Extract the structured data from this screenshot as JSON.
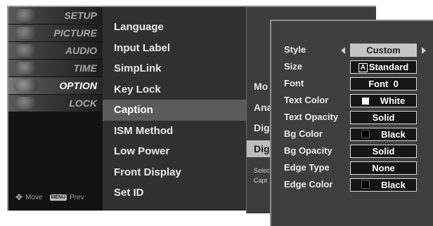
{
  "sidebar": {
    "items": [
      {
        "label": "SETUP",
        "icon": "setup-icon"
      },
      {
        "label": "PICTURE",
        "icon": "picture-icon"
      },
      {
        "label": "AUDIO",
        "icon": "audio-icon"
      },
      {
        "label": "TIME",
        "icon": "clock-icon"
      },
      {
        "label": "OPTION",
        "icon": "option-icon"
      },
      {
        "label": "LOCK",
        "icon": "lock-icon"
      }
    ],
    "active_index": 4,
    "footer": {
      "move_label": "Move",
      "menu_key": "MENU",
      "prev_label": "Prev"
    }
  },
  "menu": {
    "items": [
      "Language",
      "Input Label",
      "SimpLink",
      "Key Lock",
      "Caption",
      "ISM Method",
      "Low Power",
      "Front Display",
      "Set ID"
    ],
    "active_index": 4
  },
  "back_panel": {
    "items": [
      "Mo",
      "Ana",
      "Dig",
      "Dig"
    ],
    "highlight_index": 3,
    "description": [
      "Selec",
      "Capt"
    ]
  },
  "caption_panel": {
    "rows": [
      {
        "label": "Style",
        "value": "Custom",
        "selected": true
      },
      {
        "label": "Size",
        "value": "Standard",
        "glyph": "A"
      },
      {
        "label": "Font",
        "value": "Font  0"
      },
      {
        "label": "Text Color",
        "value": "White",
        "swatch": "#ffffff"
      },
      {
        "label": "Text Opacity",
        "value": "Solid"
      },
      {
        "label": "Bg Color",
        "value": "Black",
        "swatch": "#000000"
      },
      {
        "label": "Bg Opacity",
        "value": "Solid"
      },
      {
        "label": "Edge Type",
        "value": "None"
      },
      {
        "label": "Edge Color",
        "value": "Black",
        "swatch": "#000000"
      }
    ]
  },
  "colors": {
    "selected_value_bg": "#c4c4c4",
    "menu_active_bg": "#5a5a5a",
    "panel_bg": "#3e3e3e"
  }
}
